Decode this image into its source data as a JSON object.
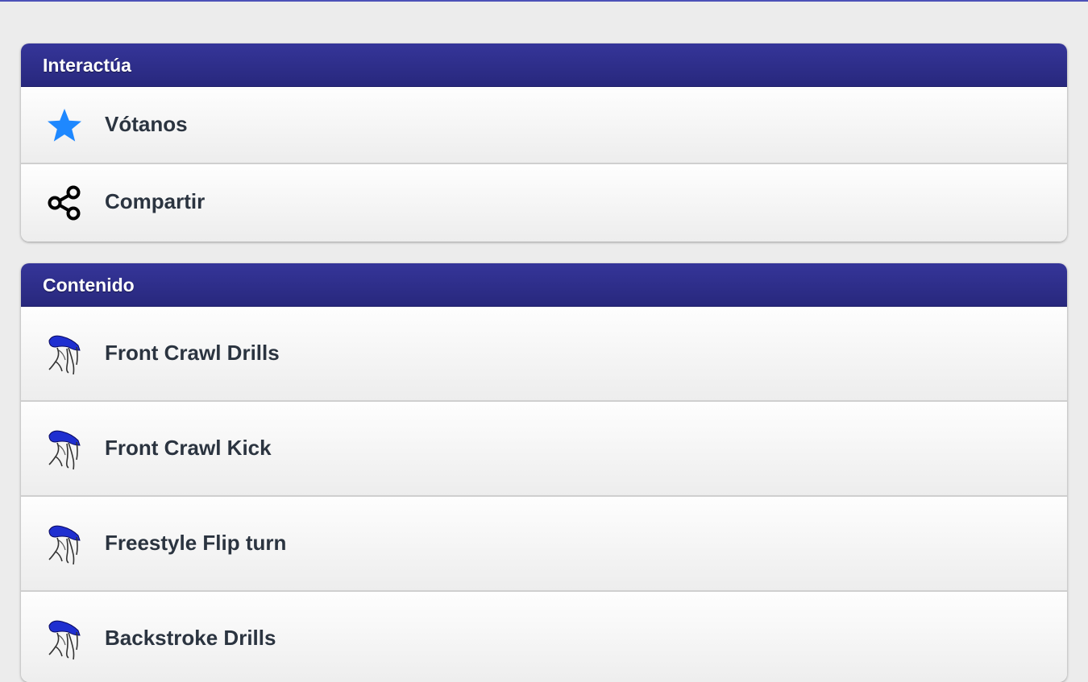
{
  "interact": {
    "title": "Interactúa",
    "items": [
      {
        "label": "Vótanos",
        "icon": "star-icon"
      },
      {
        "label": "Compartir",
        "icon": "share-icon"
      }
    ]
  },
  "content": {
    "title": "Contenido",
    "items": [
      {
        "label": "Front Crawl Drills",
        "icon": "swimmer-icon"
      },
      {
        "label": "Front Crawl Kick",
        "icon": "swimmer-icon"
      },
      {
        "label": "Freestyle Flip turn",
        "icon": "swimmer-icon"
      },
      {
        "label": "Backstroke Drills",
        "icon": "swimmer-icon"
      }
    ]
  },
  "colors": {
    "header": "#2d2d8c",
    "accent_line": "#4c51b8",
    "star": "#1e88ff",
    "text": "#2b3440"
  }
}
